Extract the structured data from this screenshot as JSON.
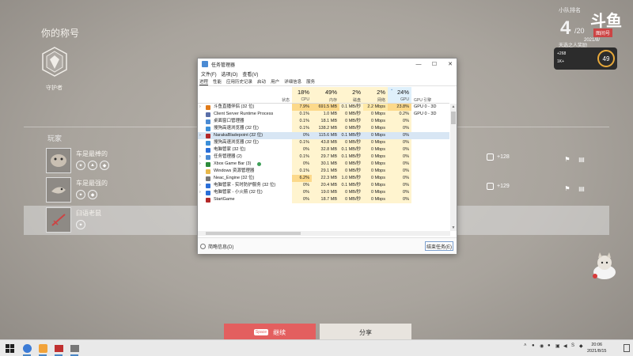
{
  "game": {
    "title": "你的称号",
    "emblem_label": "守护者",
    "players_heading": "玩家",
    "players": [
      {
        "name": "车是最棒的",
        "score": "+128"
      },
      {
        "name": "车是最强的",
        "score": "+129"
      },
      {
        "name": "臼语老鼠"
      }
    ],
    "team_rank": {
      "label": "小队排名",
      "value": "4",
      "denominator": "/20",
      "subtitle": "天选之人奖励"
    },
    "streamer": {
      "logo_text": "斗鱼",
      "sub_text": "图间号",
      "date_text": "2021/8/"
    },
    "hud": {
      "line1": "+268",
      "line2": "1K+",
      "circle_value": "49"
    },
    "continue_key": "Space",
    "continue_label": "继续",
    "share_label": "分享"
  },
  "task_manager": {
    "title": "任务管理器",
    "menu": [
      "文件(F)",
      "选项(O)",
      "查看(V)"
    ],
    "tabs": [
      "进程",
      "性能",
      "应用历史记录",
      "启动",
      "用户",
      "详细信息",
      "服务"
    ],
    "columns": {
      "status": "状态",
      "cpu": {
        "pct": "18%",
        "label": "CPU"
      },
      "memory": {
        "pct": "49%",
        "label": "内存"
      },
      "disk": {
        "pct": "2%",
        "label": "磁盘"
      },
      "network": {
        "pct": "2%",
        "label": "网络"
      },
      "gpu": {
        "pct": "24%",
        "label": "GPU"
      },
      "gpu_engine": "GPU 引擎"
    },
    "rows": [
      {
        "name": "斗鱼直播伴侣 (32 位)",
        "cpu": "7.9%",
        "mem": "691.5 MB",
        "disk": "0.1 MB/秒",
        "net": "2.2 Mbps",
        "gpu": "23.8%",
        "engine": "GPU 0 - 3D",
        "color": "#e07b1a",
        "expand": true,
        "cpu_heat": 3,
        "mem_heat": 3,
        "net_heat": 2,
        "gpu_heat": 3
      },
      {
        "name": "Client Server Runtime Process",
        "cpu": "0.1%",
        "mem": "1.0 MB",
        "disk": "0 MB/秒",
        "net": "0 Mbps",
        "gpu": "0.2%",
        "engine": "GPU 0 - 3D",
        "color": "#5a6fa8",
        "expand": false
      },
      {
        "name": "桌面窗口管理器",
        "cpu": "0.1%",
        "mem": "18.1 MB",
        "disk": "0 MB/秒",
        "net": "0 Mbps",
        "gpu": "0%",
        "engine": "",
        "color": "#4b8bd3",
        "expand": false
      },
      {
        "name": "搜狗高速浏览器 (32 位)",
        "cpu": "0.1%",
        "mem": "138.2 MB",
        "disk": "0 MB/秒",
        "net": "0 Mbps",
        "gpu": "0%",
        "engine": "",
        "color": "#3c8fd8",
        "expand": false
      },
      {
        "name": "NarakaBladepoint (32 位)",
        "cpu": "0%",
        "mem": "115.6 MB",
        "disk": "0.1 MB/秒",
        "net": "0 Mbps",
        "gpu": "0%",
        "engine": "",
        "color": "#b32828",
        "expand": true,
        "selected": true
      },
      {
        "name": "搜狗高速浏览器 (32 位)",
        "cpu": "0.1%",
        "mem": "43.8 MB",
        "disk": "0 MB/秒",
        "net": "0 Mbps",
        "gpu": "0%",
        "engine": "",
        "color": "#3c8fd8",
        "expand": false
      },
      {
        "name": "电脑管家 (32 位)",
        "cpu": "0%",
        "mem": "32.8 MB",
        "disk": "0.1 MB/秒",
        "net": "0 Mbps",
        "gpu": "0%",
        "engine": "",
        "color": "#2b6fd8",
        "expand": false
      },
      {
        "name": "任务管理器 (2)",
        "cpu": "0.1%",
        "mem": "29.7 MB",
        "disk": "0.1 MB/秒",
        "net": "0 Mbps",
        "gpu": "0%",
        "engine": "",
        "color": "#4b8bd3",
        "expand": true
      },
      {
        "name": "Xbox Game Bar (3)",
        "cpu": "0%",
        "mem": "30.1 MB",
        "disk": "0 MB/秒",
        "net": "0 Mbps",
        "gpu": "0%",
        "engine": "",
        "color": "#2e8b3b",
        "expand": true,
        "eco": true
      },
      {
        "name": "Windows 资源管理器",
        "cpu": "0.1%",
        "mem": "29.1 MB",
        "disk": "0 MB/秒",
        "net": "0 Mbps",
        "gpu": "0%",
        "engine": "",
        "color": "#e8b84a",
        "expand": false
      },
      {
        "name": "Neac_Engine (32 位)",
        "cpu": "6.2%",
        "mem": "22.3 MB",
        "disk": "1.0 MB/秒",
        "net": "0 Mbps",
        "gpu": "0%",
        "engine": "",
        "color": "#777777",
        "expand": false,
        "cpu_heat": 3
      },
      {
        "name": "电脑管家 - 实时防护服务 (32 位)",
        "cpu": "0%",
        "mem": "20.4 MB",
        "disk": "0.1 MB/秒",
        "net": "0 Mbps",
        "gpu": "0%",
        "engine": "",
        "color": "#2b6fd8",
        "expand": true
      },
      {
        "name": "电脑管家 - 小火箭 (32 位)",
        "cpu": "0%",
        "mem": "19.0 MB",
        "disk": "0 MB/秒",
        "net": "0 Mbps",
        "gpu": "0%",
        "engine": "",
        "color": "#2b6fd8",
        "expand": true
      },
      {
        "name": "StartGame",
        "cpu": "0%",
        "mem": "18.7 MB",
        "disk": "0 MB/秒",
        "net": "0 Mbps",
        "gpu": "0%",
        "engine": "",
        "color": "#b32828",
        "expand": false
      }
    ],
    "brief_label": "简略信息(D)",
    "end_task_label": "结束任务(E)"
  },
  "taskbar": {
    "time": "20:06",
    "date": "2021/8/15",
    "apps": [
      "start",
      "browser",
      "torch",
      "game",
      "camera",
      "task-manager"
    ]
  },
  "colors": {
    "accent_red": "#e35f5f",
    "heat": "#fff4cf",
    "selection": "#d8e6f4"
  }
}
